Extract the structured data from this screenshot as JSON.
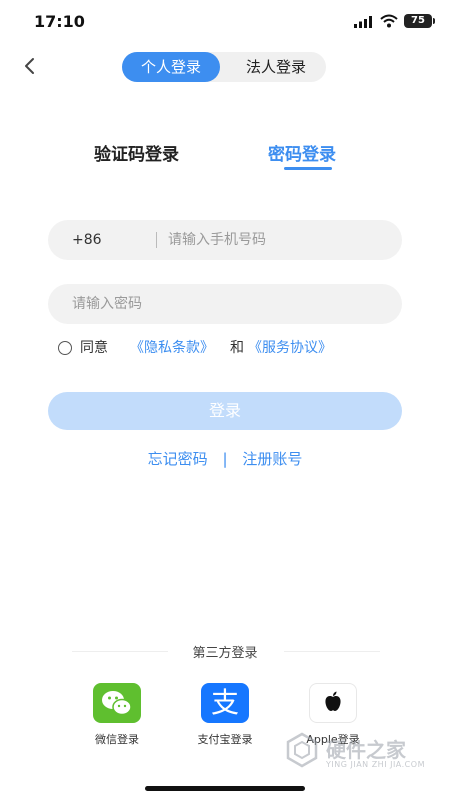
{
  "status_bar": {
    "time": "17:10",
    "battery": "75"
  },
  "header": {
    "back_icon": "chevron-left-icon",
    "login_types": [
      {
        "label": "个人登录",
        "selected": true
      },
      {
        "label": "法人登录",
        "selected": false
      }
    ]
  },
  "tabs": [
    {
      "label": "验证码登录",
      "active": false
    },
    {
      "label": "密码登录",
      "active": true
    }
  ],
  "form": {
    "country_code": "+86",
    "phone_placeholder": "请输入手机号码",
    "password_placeholder": "请输入密码",
    "agreement": {
      "prefix": "同意",
      "privacy_link": "《隐私条款》",
      "conjunction": "和",
      "service_link": "《服务协议》"
    },
    "login_button": "登录"
  },
  "links": {
    "forgot_password": "忘记密码",
    "separator": "|",
    "register": "注册账号"
  },
  "third_party": {
    "title": "第三方登录",
    "options": [
      {
        "label": "微信登录",
        "icon": "wechat-icon"
      },
      {
        "label": "支付宝登录",
        "icon": "alipay-icon"
      },
      {
        "label": "Apple登录",
        "icon": "apple-icon"
      }
    ]
  },
  "watermark": {
    "text": "硬件之家",
    "sub": "YING JIAN ZHI JIA.COM"
  },
  "colors": {
    "accent": "#3d8ef0",
    "button_disabled": "#c2dcfb",
    "wechat": "#5fbf2f",
    "alipay": "#1677ff"
  }
}
